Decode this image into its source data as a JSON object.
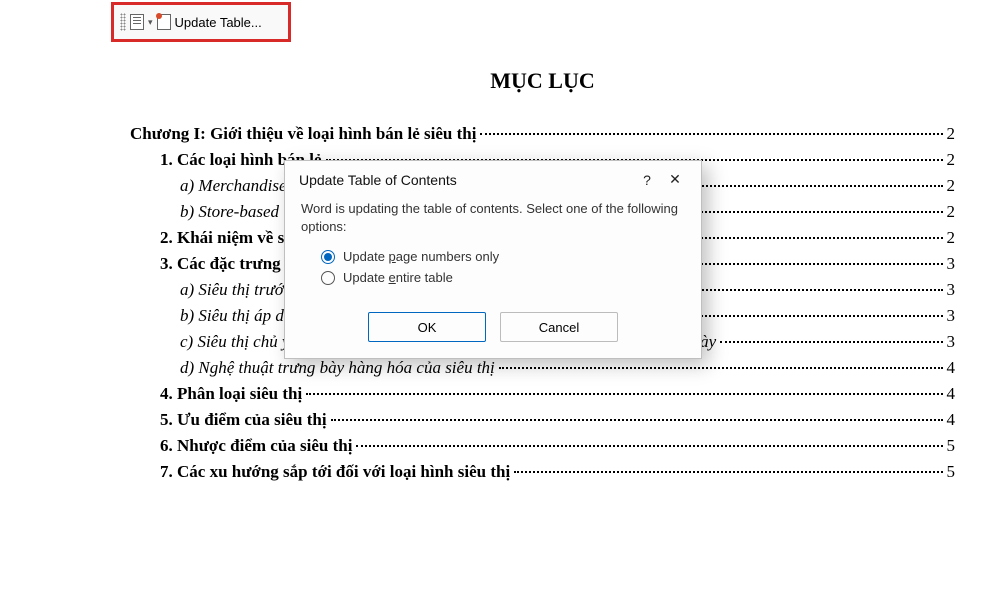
{
  "toolbar": {
    "update_label": "Update Table..."
  },
  "document": {
    "title": "MỤC LỤC",
    "toc": [
      {
        "level": 0,
        "text": "Chương I: Giới thiệu về loại hình bán lẻ siêu thị",
        "page": "2"
      },
      {
        "level": 1,
        "text": "1. Các loại hình bán lẻ",
        "page": "2"
      },
      {
        "level": 2,
        "text": "a) Merchandise",
        "page": "2"
      },
      {
        "level": 2,
        "text": "b) Store-based r",
        "page": "2"
      },
      {
        "level": 1,
        "text": "2. Khái niệm về s",
        "page": "2"
      },
      {
        "level": 1,
        "text": "3. Các đặc trưng",
        "page": "3"
      },
      {
        "level": 2,
        "text": "a) Siêu thị trước",
        "page": "3"
      },
      {
        "level": 2,
        "text": "b) Siêu thị áp dụng phương thức tự phục vụ (self-service)",
        "page": "3"
      },
      {
        "level": 2,
        "text": "c) Siêu thị chủ yếu kinh doanh hàng hóa đáp ứng nhu cầu tiêu dùng hàng ngày",
        "page": "3"
      },
      {
        "level": 2,
        "text": "d) Nghệ thuật trưng bày hàng hóa của siêu thị",
        "page": "4"
      },
      {
        "level": 1,
        "text": "4. Phân loại siêu thị",
        "page": "4"
      },
      {
        "level": 1,
        "text": "5. Ưu điểm của siêu thị",
        "page": "4"
      },
      {
        "level": 1,
        "text": "6. Nhược điểm của siêu thị",
        "page": "5"
      },
      {
        "level": 1,
        "text": "7. Các xu hướng sắp tới đối với loại hình siêu thị",
        "page": "5"
      }
    ]
  },
  "dialog": {
    "title": "Update Table of Contents",
    "help": "?",
    "close": "✕",
    "message": "Word is updating the table of contents.  Select one of the following options:",
    "option1_pre": "Update ",
    "option1_u": "p",
    "option1_post": "age numbers only",
    "option2_pre": "Update ",
    "option2_u": "e",
    "option2_post": "ntire table",
    "ok": "OK",
    "cancel": "Cancel",
    "selected": "page_numbers_only"
  }
}
